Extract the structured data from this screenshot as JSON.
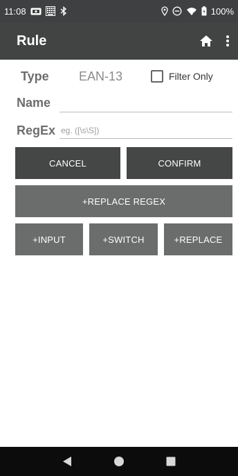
{
  "status_bar": {
    "time": "11:08",
    "battery_percent": "100%",
    "left_icons": [
      "notification-icon",
      "keyboard-icon",
      "bluetooth-icon"
    ],
    "right_icons": [
      "location-icon",
      "do-not-disturb-icon",
      "wifi-icon",
      "battery-icon"
    ]
  },
  "app_bar": {
    "title": "Rule",
    "actions": [
      "home-icon",
      "more-vert-icon"
    ]
  },
  "form": {
    "type_label": "Type",
    "type_value": "EAN-13",
    "filter_only_label": "Filter Only",
    "filter_only_checked": false,
    "name_label": "Name",
    "name_value": "",
    "regex_label": "RegEx",
    "regex_value": "",
    "regex_placeholder": "eg. ([\\s\\S])"
  },
  "buttons": {
    "cancel": "CANCEL",
    "confirm": "CONFIRM",
    "replace_regex": "+REPLACE REGEX",
    "input": "+INPUT",
    "switch": "+SWITCH",
    "replace": "+REPLACE"
  },
  "nav_bar": {
    "items": [
      "back-icon",
      "home-circle-icon",
      "recents-icon"
    ]
  },
  "colors": {
    "status_bar": "#3f4041",
    "app_bar": "#424343",
    "button_dark": "#454646",
    "button_mid": "#6b6c6c",
    "nav_bar": "#0c0c0c"
  }
}
